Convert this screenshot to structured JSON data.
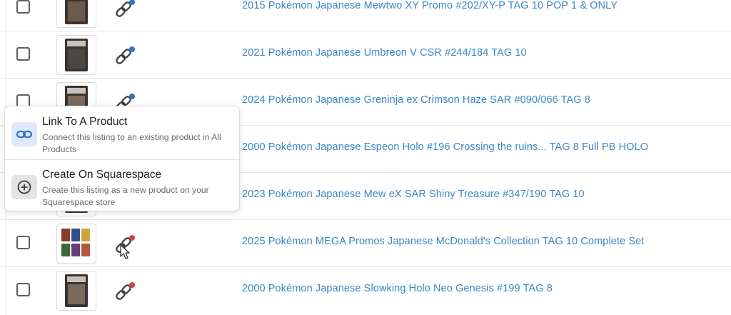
{
  "listings": [
    {
      "title": "2015 Pokémon Japanese Mewtwo XY Promo #202/XY-P TAG 10 POP 1 & ONLY",
      "link_status": "blue"
    },
    {
      "title": "2021 Pokémon Japanese Umbreon V CSR #244/184 TAG 10",
      "link_status": "blue"
    },
    {
      "title": "2024 Pokémon Japanese Greninja ex Crimson Haze SAR #090/066 TAG 8",
      "link_status": "blue"
    },
    {
      "title": "2000 Pokémon Japanese Espeon Holo #196 Crossing the ruins... TAG 8 Full PB HOLO",
      "link_status": "hidden"
    },
    {
      "title": "2023 Pokémon Japanese Mew eX SAR Shiny Treasure #347/190 TAG 10",
      "link_status": "hidden"
    },
    {
      "title": "2025 Pokémon MEGA Promos Japanese McDonald's Collection TAG 10 Complete Set",
      "link_status": "red"
    },
    {
      "title": "2000 Pokémon Japanese Slowking Holo Neo Genesis #199 TAG 8",
      "link_status": "red"
    }
  ],
  "popup": {
    "link_item": {
      "title": "Link To A Product",
      "description": "Connect this listing to an existing product in All Products"
    },
    "create_item": {
      "title": "Create On Squarespace",
      "description": "Create this listing as a new product on your Squarespace store"
    }
  },
  "colors": {
    "link_title": "#3a86c6",
    "status_blue": "#2f74c7",
    "status_red": "#d9413b",
    "icon_stroke": "#3a3a3a"
  },
  "icons": {
    "row_link": "chain-link-icon",
    "popup_link": "chain-link-icon",
    "popup_create": "plus-circle-icon",
    "cursor": "mouse-pointer-icon"
  }
}
